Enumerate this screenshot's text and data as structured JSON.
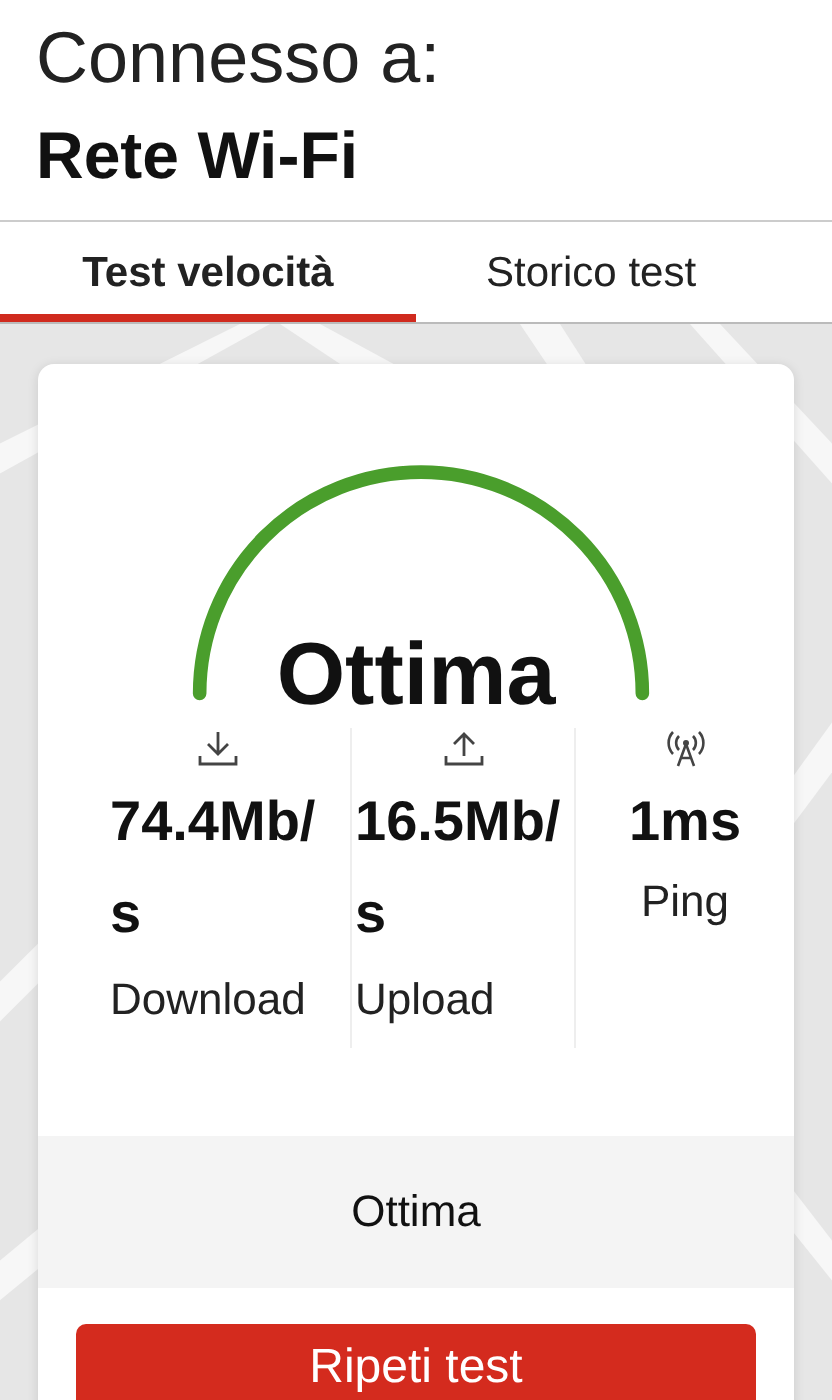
{
  "header": {
    "subtitle": "Connesso a:",
    "network": "Rete Wi-Fi"
  },
  "tabs": [
    {
      "label": "Test velocità",
      "selected": true
    },
    {
      "label": "Storico test",
      "selected": false
    }
  ],
  "result": {
    "rating": "Ottima",
    "metrics": [
      {
        "kind": "download",
        "value": "74.4Mb/s",
        "label": "Download"
      },
      {
        "kind": "upload",
        "value": "16.5Mb/s",
        "label": "Upload"
      },
      {
        "kind": "ping",
        "value": "1ms",
        "label": "Ping"
      }
    ],
    "summary": "Ottima",
    "button": "Ripeti test"
  }
}
